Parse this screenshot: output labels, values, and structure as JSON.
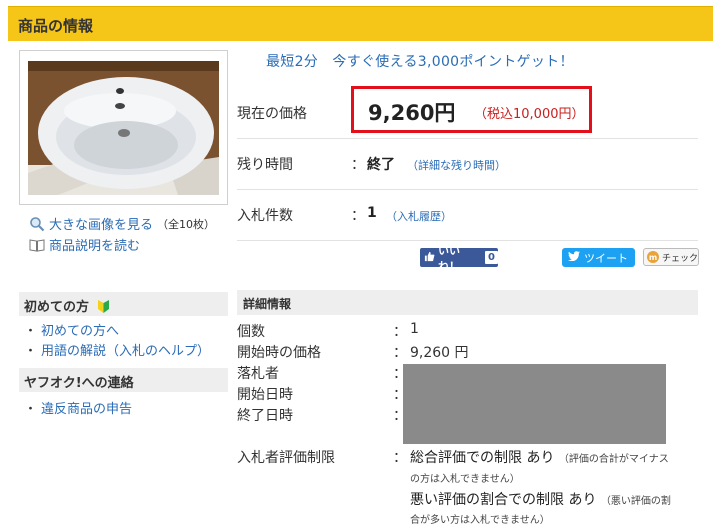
{
  "header": {
    "title": "商品の情報"
  },
  "promo": "最短2分　今すぐ使える3,000ポイントゲット！",
  "sidebar": {
    "view_large": "大きな画像を見る",
    "view_large_count": "（全10枚）",
    "read_desc": "商品説明を読む",
    "beginner_title": "初めての方",
    "beginner_links": [
      "初めての方へ",
      "用語の解説（入札のヘルプ）"
    ],
    "contact_title": "ヤフオク!への連絡",
    "contact_links": [
      "違反商品の申告"
    ]
  },
  "info": {
    "price_label": "現在の価格",
    "price": "9,260円",
    "price_tax": "（税込10,000円）",
    "time_label": "残り時間",
    "time_colon": "：",
    "time_value": "終了",
    "time_link": "（詳細な残り時間）",
    "bids_label": "入札件数",
    "bids_colon": "：",
    "bids_value": "1",
    "bids_link": "（入札履歴）"
  },
  "social": {
    "like_label": "いいね！",
    "like_count": "0",
    "tweet_label": "ツイート",
    "check_label": "チェック"
  },
  "details": {
    "title": "詳細情報",
    "rows": [
      {
        "label": "個数",
        "colon": "：",
        "value": "1"
      },
      {
        "label": "開始時の価格",
        "colon": "：",
        "value": "9,260 円"
      },
      {
        "label": "落札者",
        "colon": "：",
        "value": ""
      },
      {
        "label": "開始日時",
        "colon": "：",
        "value": ""
      },
      {
        "label": "終了日時",
        "colon": "：",
        "value": ""
      }
    ],
    "limit_label": "入札者評価制限",
    "limit_colon": "：",
    "limit1_main": "総合評価での制限 あり",
    "limit1_note_a": "（評価の合計がマイナス",
    "limit1_note_b": "の方は入札できません）",
    "limit2_main": "悪い評価の割合での制限 あり",
    "limit2_note_a": "（悪い評価の割",
    "limit2_note_b": "合が多い方は入札できません）"
  },
  "colors": {
    "header": "#f5c518",
    "price_border": "#e3101b",
    "link": "#2a6cb6",
    "facebook": "#3b5998",
    "twitter": "#1da1f2"
  }
}
